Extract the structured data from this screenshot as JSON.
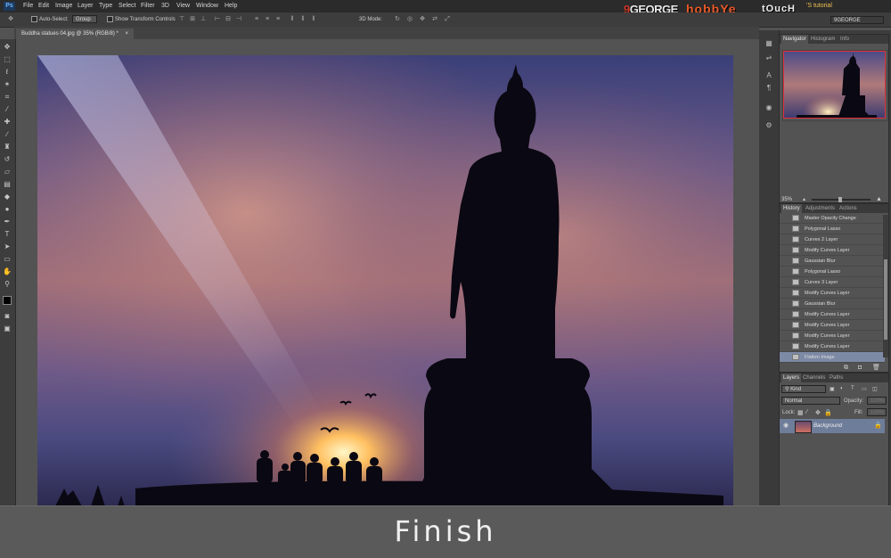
{
  "menubar": {
    "app_logo": "Ps",
    "items": [
      "File",
      "Edit",
      "Image",
      "Layer",
      "Type",
      "Select",
      "Filter",
      "3D",
      "View",
      "Window",
      "Help"
    ]
  },
  "brand": {
    "part1_num": "9",
    "part1": "GEORGE",
    "part2": "hobbYe",
    "part3": "tOucH",
    "part4": "'S tutorial",
    "small": "GEORGE HOBBY TOUCH"
  },
  "workspace": {
    "selected": "9GEORGE"
  },
  "options_bar": {
    "auto_select_label": "Auto-Select:",
    "auto_select_value": "Group",
    "show_transform_label": "Show Transform Controls",
    "mode_3d_label": "3D Mode:"
  },
  "document": {
    "tab_title": "Buddha statues 04.jpg @ 35% (RGB/8) *"
  },
  "navigator": {
    "tabs": [
      "Navigator",
      "Histogram",
      "Info"
    ],
    "zoom": "35%"
  },
  "history": {
    "tabs": [
      "History",
      "Adjustments",
      "Actions"
    ],
    "items": [
      "Master Opacity Change",
      "Polygonal Lasso",
      "Curves 2 Layer",
      "Modify Curves Layer",
      "Gaussian Blur",
      "Polygonal Lasso",
      "Curves 3 Layer",
      "Modify Curves Layer",
      "Gaussian Blur",
      "Modify Curves Layer",
      "Modify Curves Layer",
      "Modify Curves Layer",
      "Modify Curves Layer",
      "Flatten Image"
    ]
  },
  "layers": {
    "tabs": [
      "Layers",
      "Channels",
      "Paths"
    ],
    "filter_kind": "Kind",
    "blend_mode": "Normal",
    "opacity_label": "Opacity:",
    "opacity_value": "100%",
    "lock_label": "Lock:",
    "fill_label": "Fill:",
    "fill_value": "100%",
    "layer_name": "Background"
  },
  "caption": {
    "text": "Finish"
  },
  "colors": {
    "ui_dark": "#2b2b2b",
    "ui_panel": "#535353",
    "selection": "#7d8aa6",
    "nav_frame": "#e0303a"
  }
}
